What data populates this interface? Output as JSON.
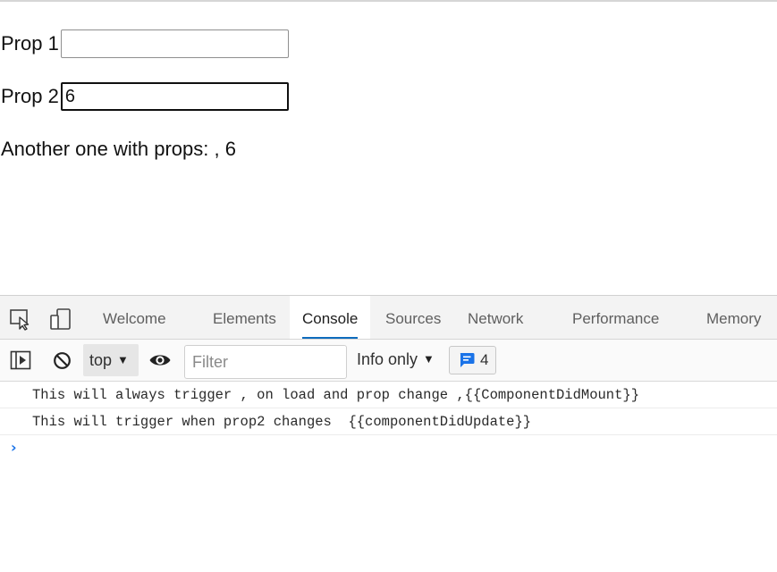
{
  "app": {
    "prop1_label": "Prop 1",
    "prop1_value": "",
    "prop2_label": "Prop 2",
    "prop2_value": "6",
    "result_text": "Another one with props: , 6"
  },
  "devtools": {
    "tabs": [
      {
        "label": "Welcome",
        "active": false
      },
      {
        "label": "Elements",
        "active": false
      },
      {
        "label": "Console",
        "active": true
      },
      {
        "label": "Sources",
        "active": false
      },
      {
        "label": "Network",
        "active": false
      },
      {
        "label": "Performance",
        "active": false
      },
      {
        "label": "Memory",
        "active": false
      }
    ],
    "toolbar": {
      "context": "top",
      "filter_placeholder": "Filter",
      "level": "Info only",
      "message_count": "4"
    },
    "console_lines": [
      "This will always trigger , on load and prop change ,{{ComponentDidMount}}",
      "This will trigger when prop2 changes  {{componentDidUpdate}}"
    ],
    "prompt_symbol": "›",
    "accent_color": "#0f6cbd",
    "prompt_color": "#1a73e8"
  }
}
